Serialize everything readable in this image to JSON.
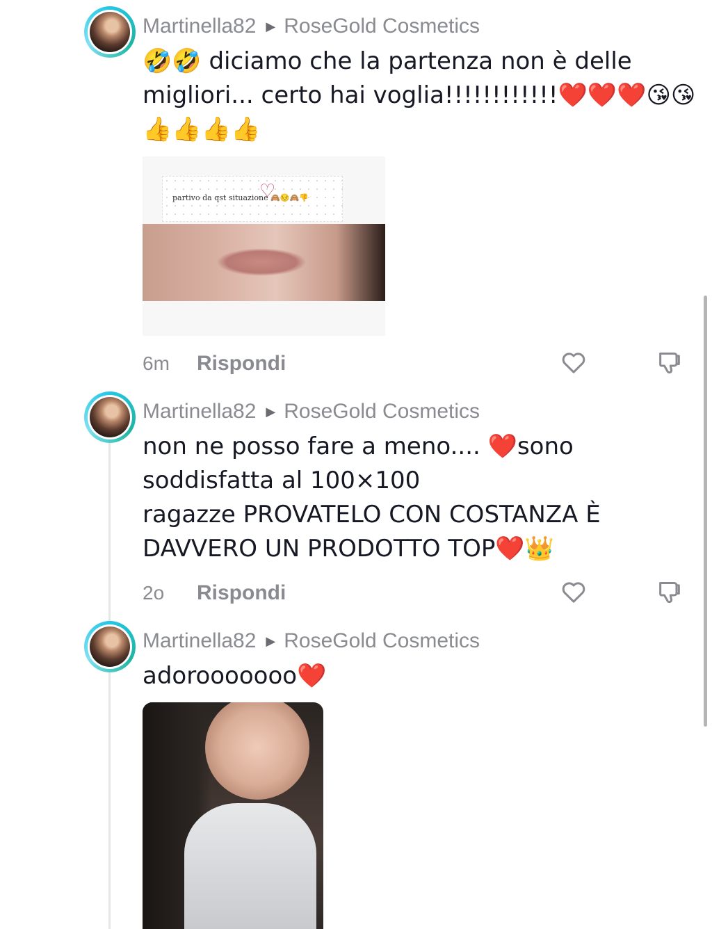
{
  "comments": [
    {
      "username": "Martinella82",
      "reply_to": "RoseGold Cosmetics",
      "text": "🤣🤣 diciamo che la partenza non è delle migliori... certo hai voglia!!!!!!!!!!!!❤️❤️❤️😘😘👍👍👍👍",
      "attachment_caption": "partivo da qst situazione 🙈😔🙈👎",
      "time": "6m",
      "reply_label": "Rispondi"
    },
    {
      "username": "Martinella82",
      "reply_to": "RoseGold Cosmetics",
      "text": "non ne posso fare a meno.... ❤️sono soddisfatta al 100×100\nragazze PROVATELO CON COSTANZA È DAVVERO UN PRODOTTO TOP❤️👑",
      "time": "2o",
      "reply_label": "Rispondi"
    },
    {
      "username": "Martinella82",
      "reply_to": "RoseGold Cosmetics",
      "text": "adorooooooo❤️"
    }
  ],
  "icons": {
    "separator": "triangle-right-icon",
    "like": "heart-outline-icon",
    "dislike": "thumbs-down-outline-icon"
  },
  "colors": {
    "text": "#161823",
    "secondary": "#8a8b91",
    "avatar_ring": "#24c6e6"
  }
}
